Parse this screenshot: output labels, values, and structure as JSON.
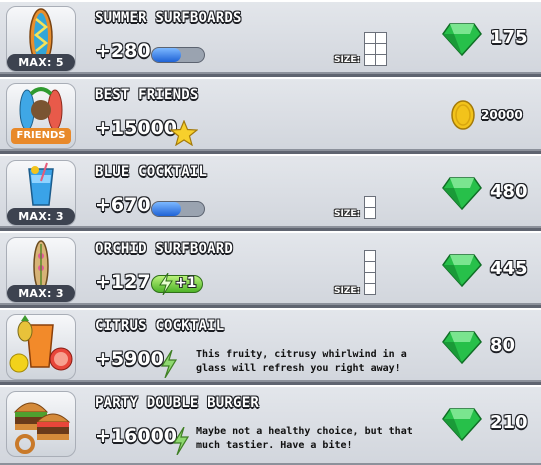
{
  "items": [
    {
      "title": "SUMMER SURFBOARDS",
      "value": "+280",
      "max": "MAX: 5",
      "size_label": "SIZE:",
      "price": "175",
      "currency": "gem-icon",
      "progress": 0.55
    },
    {
      "title": "BEST FRIENDS",
      "value": "+15000",
      "badge": "FRIENDS",
      "price": "20000",
      "currency": "coin-icon"
    },
    {
      "title": "BLUE COCKTAIL",
      "value": "+670",
      "max": "MAX: 3",
      "size_label": "SIZE:",
      "price": "480",
      "currency": "gem-icon",
      "progress": 0.55
    },
    {
      "title": "ORCHID SURFBOARD",
      "value": "+127",
      "max": "MAX: 3",
      "size_label": "SIZE:",
      "boost": "+1",
      "price": "445",
      "currency": "gem-icon"
    },
    {
      "title": "CITRUS COCKTAIL",
      "value": "+5900",
      "description": "This fruity, citrusy whirlwind in a glass will refresh you right away!",
      "price": "80",
      "currency": "gem-icon"
    },
    {
      "title": "PARTY DOUBLE BURGER",
      "value": "+16000",
      "description": "Maybe not a healthy choice, but that much tastier. Have a bite!",
      "price": "210",
      "currency": "gem-icon"
    }
  ],
  "colors": {
    "gem": "#27c04a",
    "coin": "#f2c31b",
    "progress": "#2a6fe0",
    "boost": "#5cc534",
    "background": "#dde0e5"
  }
}
